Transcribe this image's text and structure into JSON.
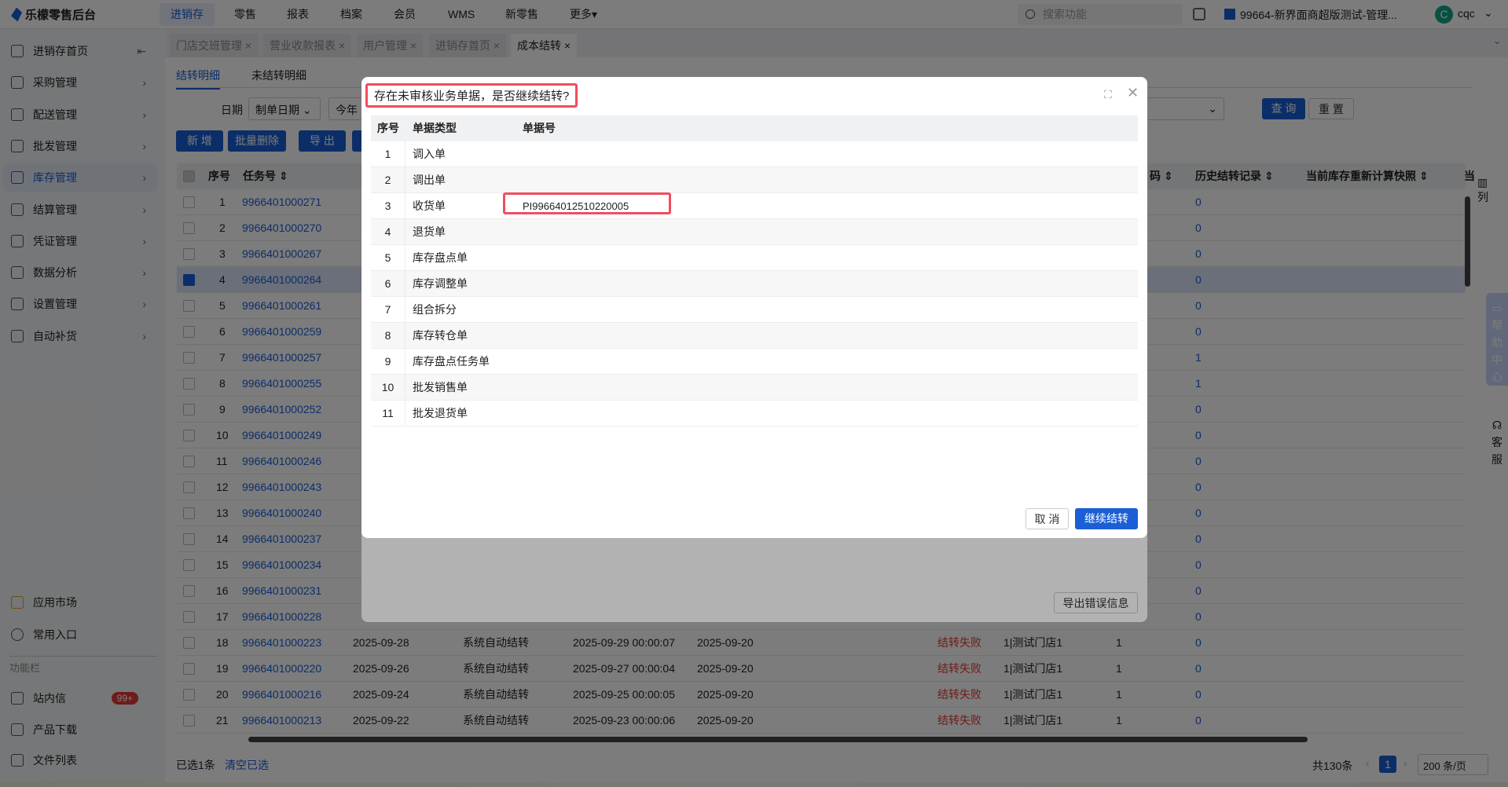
{
  "app": {
    "title": "乐檬零售后台"
  },
  "topnav": {
    "items": [
      "进销存",
      "零售",
      "报表",
      "档案",
      "会员",
      "WMS",
      "新零售",
      "更多▾"
    ],
    "search_placeholder": "搜索功能",
    "store": "99664-新界面商超版测试-管理...",
    "avatar_letter": "C",
    "user": "cqc"
  },
  "sidebar": {
    "items": [
      {
        "label": "进销存首页",
        "icon": "home-icon"
      },
      {
        "label": "采购管理",
        "icon": "cart-icon"
      },
      {
        "label": "配送管理",
        "icon": "delivery-icon"
      },
      {
        "label": "批发管理",
        "icon": "wholesale-icon"
      },
      {
        "label": "库存管理",
        "icon": "inventory-icon"
      },
      {
        "label": "结算管理",
        "icon": "settlement-icon"
      },
      {
        "label": "凭证管理",
        "icon": "voucher-icon"
      },
      {
        "label": "数据分析",
        "icon": "chart-icon"
      },
      {
        "label": "设置管理",
        "icon": "gear-icon"
      },
      {
        "label": "自动补货",
        "icon": "replenish-icon"
      }
    ],
    "bottom": {
      "app_market": "应用市场",
      "favorites": "常用入口",
      "section": "功能栏",
      "messages": "站内信",
      "messages_badge": "99+",
      "download": "产品下载",
      "files": "文件列表"
    }
  },
  "tabs": [
    "门店交班管理",
    "营业收款报表",
    "用户管理",
    "进销存首页",
    "成本结转"
  ],
  "subtabs": [
    "结转明细",
    "未结转明细"
  ],
  "filters": {
    "date_label": "日期",
    "date_type": "制单日期",
    "date_range": "今年",
    "query": "查 询",
    "reset": "重 置"
  },
  "toolbar": {
    "add": "新 增",
    "batch_delete": "批量删除",
    "export": "导 出"
  },
  "table": {
    "headers": {
      "seq": "序号",
      "task_no": "任务号",
      "code": "码",
      "history": "历史结转记录",
      "snapshot": "当前库存重新计算快照",
      "current": "当",
      "columns": "列"
    },
    "rows": [
      {
        "seq": "1",
        "id": "9966401000271",
        "history": "0"
      },
      {
        "seq": "2",
        "id": "9966401000270",
        "history": "0"
      },
      {
        "seq": "3",
        "id": "9966401000267",
        "history": "0"
      },
      {
        "seq": "4",
        "id": "9966401000264",
        "history": "0",
        "selected": true
      },
      {
        "seq": "5",
        "id": "9966401000261",
        "history": "0"
      },
      {
        "seq": "6",
        "id": "9966401000259",
        "history": "0"
      },
      {
        "seq": "7",
        "id": "9966401000257",
        "history": "1"
      },
      {
        "seq": "8",
        "id": "9966401000255",
        "history": "1"
      },
      {
        "seq": "9",
        "id": "9966401000252",
        "history": "0"
      },
      {
        "seq": "10",
        "id": "9966401000249",
        "history": "0"
      },
      {
        "seq": "11",
        "id": "9966401000246",
        "history": "0"
      },
      {
        "seq": "12",
        "id": "9966401000243",
        "history": "0"
      },
      {
        "seq": "13",
        "id": "9966401000240",
        "history": "0"
      },
      {
        "seq": "14",
        "id": "9966401000237",
        "history": "0"
      },
      {
        "seq": "15",
        "id": "9966401000234",
        "history": "0"
      },
      {
        "seq": "16",
        "id": "9966401000231",
        "history": "0"
      },
      {
        "seq": "17",
        "id": "9966401000228",
        "history": "0"
      },
      {
        "seq": "18",
        "id": "9966401000223",
        "date": "2025-09-28",
        "type": "系统自动结转",
        "created": "2025-09-29 00:00:07",
        "period": "2025-09-20",
        "status": "结转失败",
        "store": "1|测试门店1",
        "count": "1",
        "history": "0"
      },
      {
        "seq": "19",
        "id": "9966401000220",
        "date": "2025-09-26",
        "type": "系统自动结转",
        "created": "2025-09-27 00:00:04",
        "period": "2025-09-20",
        "status": "结转失败",
        "store": "1|测试门店1",
        "count": "1",
        "history": "0"
      },
      {
        "seq": "20",
        "id": "9966401000216",
        "date": "2025-09-24",
        "type": "系统自动结转",
        "created": "2025-09-25 00:00:05",
        "period": "2025-09-20",
        "status": "结转失败",
        "store": "1|测试门店1",
        "count": "1",
        "history": "0"
      },
      {
        "seq": "21",
        "id": "9966401000213",
        "date": "2025-09-22",
        "type": "系统自动结转",
        "created": "2025-09-23 00:00:06",
        "period": "2025-09-20",
        "status": "结转失败",
        "store": "1|测试门店1",
        "count": "1",
        "history": "0"
      }
    ]
  },
  "footer": {
    "selected": "已选1条",
    "clear": "清空已选",
    "total": "共130条",
    "page": "1",
    "page_size": "200 条/页"
  },
  "error_modal": {
    "export_errors": "导出错误信息"
  },
  "dialog": {
    "title": "存在未审核业务单据，是否继续结转?",
    "headers": [
      "序号",
      "单据类型",
      "单据号"
    ],
    "rows": [
      {
        "seq": "1",
        "type": "调入单",
        "no": ""
      },
      {
        "seq": "2",
        "type": "调出单",
        "no": ""
      },
      {
        "seq": "3",
        "type": "收货单",
        "no": "PI99664012510220005"
      },
      {
        "seq": "4",
        "type": "退货单",
        "no": ""
      },
      {
        "seq": "5",
        "type": "库存盘点单",
        "no": ""
      },
      {
        "seq": "6",
        "type": "库存调整单",
        "no": ""
      },
      {
        "seq": "7",
        "type": "组合拆分",
        "no": ""
      },
      {
        "seq": "8",
        "type": "库存转仓单",
        "no": ""
      },
      {
        "seq": "9",
        "type": "库存盘点任务单",
        "no": ""
      },
      {
        "seq": "10",
        "type": "批发销售单",
        "no": ""
      },
      {
        "seq": "11",
        "type": "批发退货单",
        "no": ""
      }
    ],
    "cancel": "取 消",
    "confirm": "继续结转"
  },
  "floats": {
    "help": "帮助中心",
    "service": "客服"
  },
  "colors": {
    "primary": "#1a5fd6",
    "danger": "#e53935",
    "highlight": "#f04e5e"
  }
}
